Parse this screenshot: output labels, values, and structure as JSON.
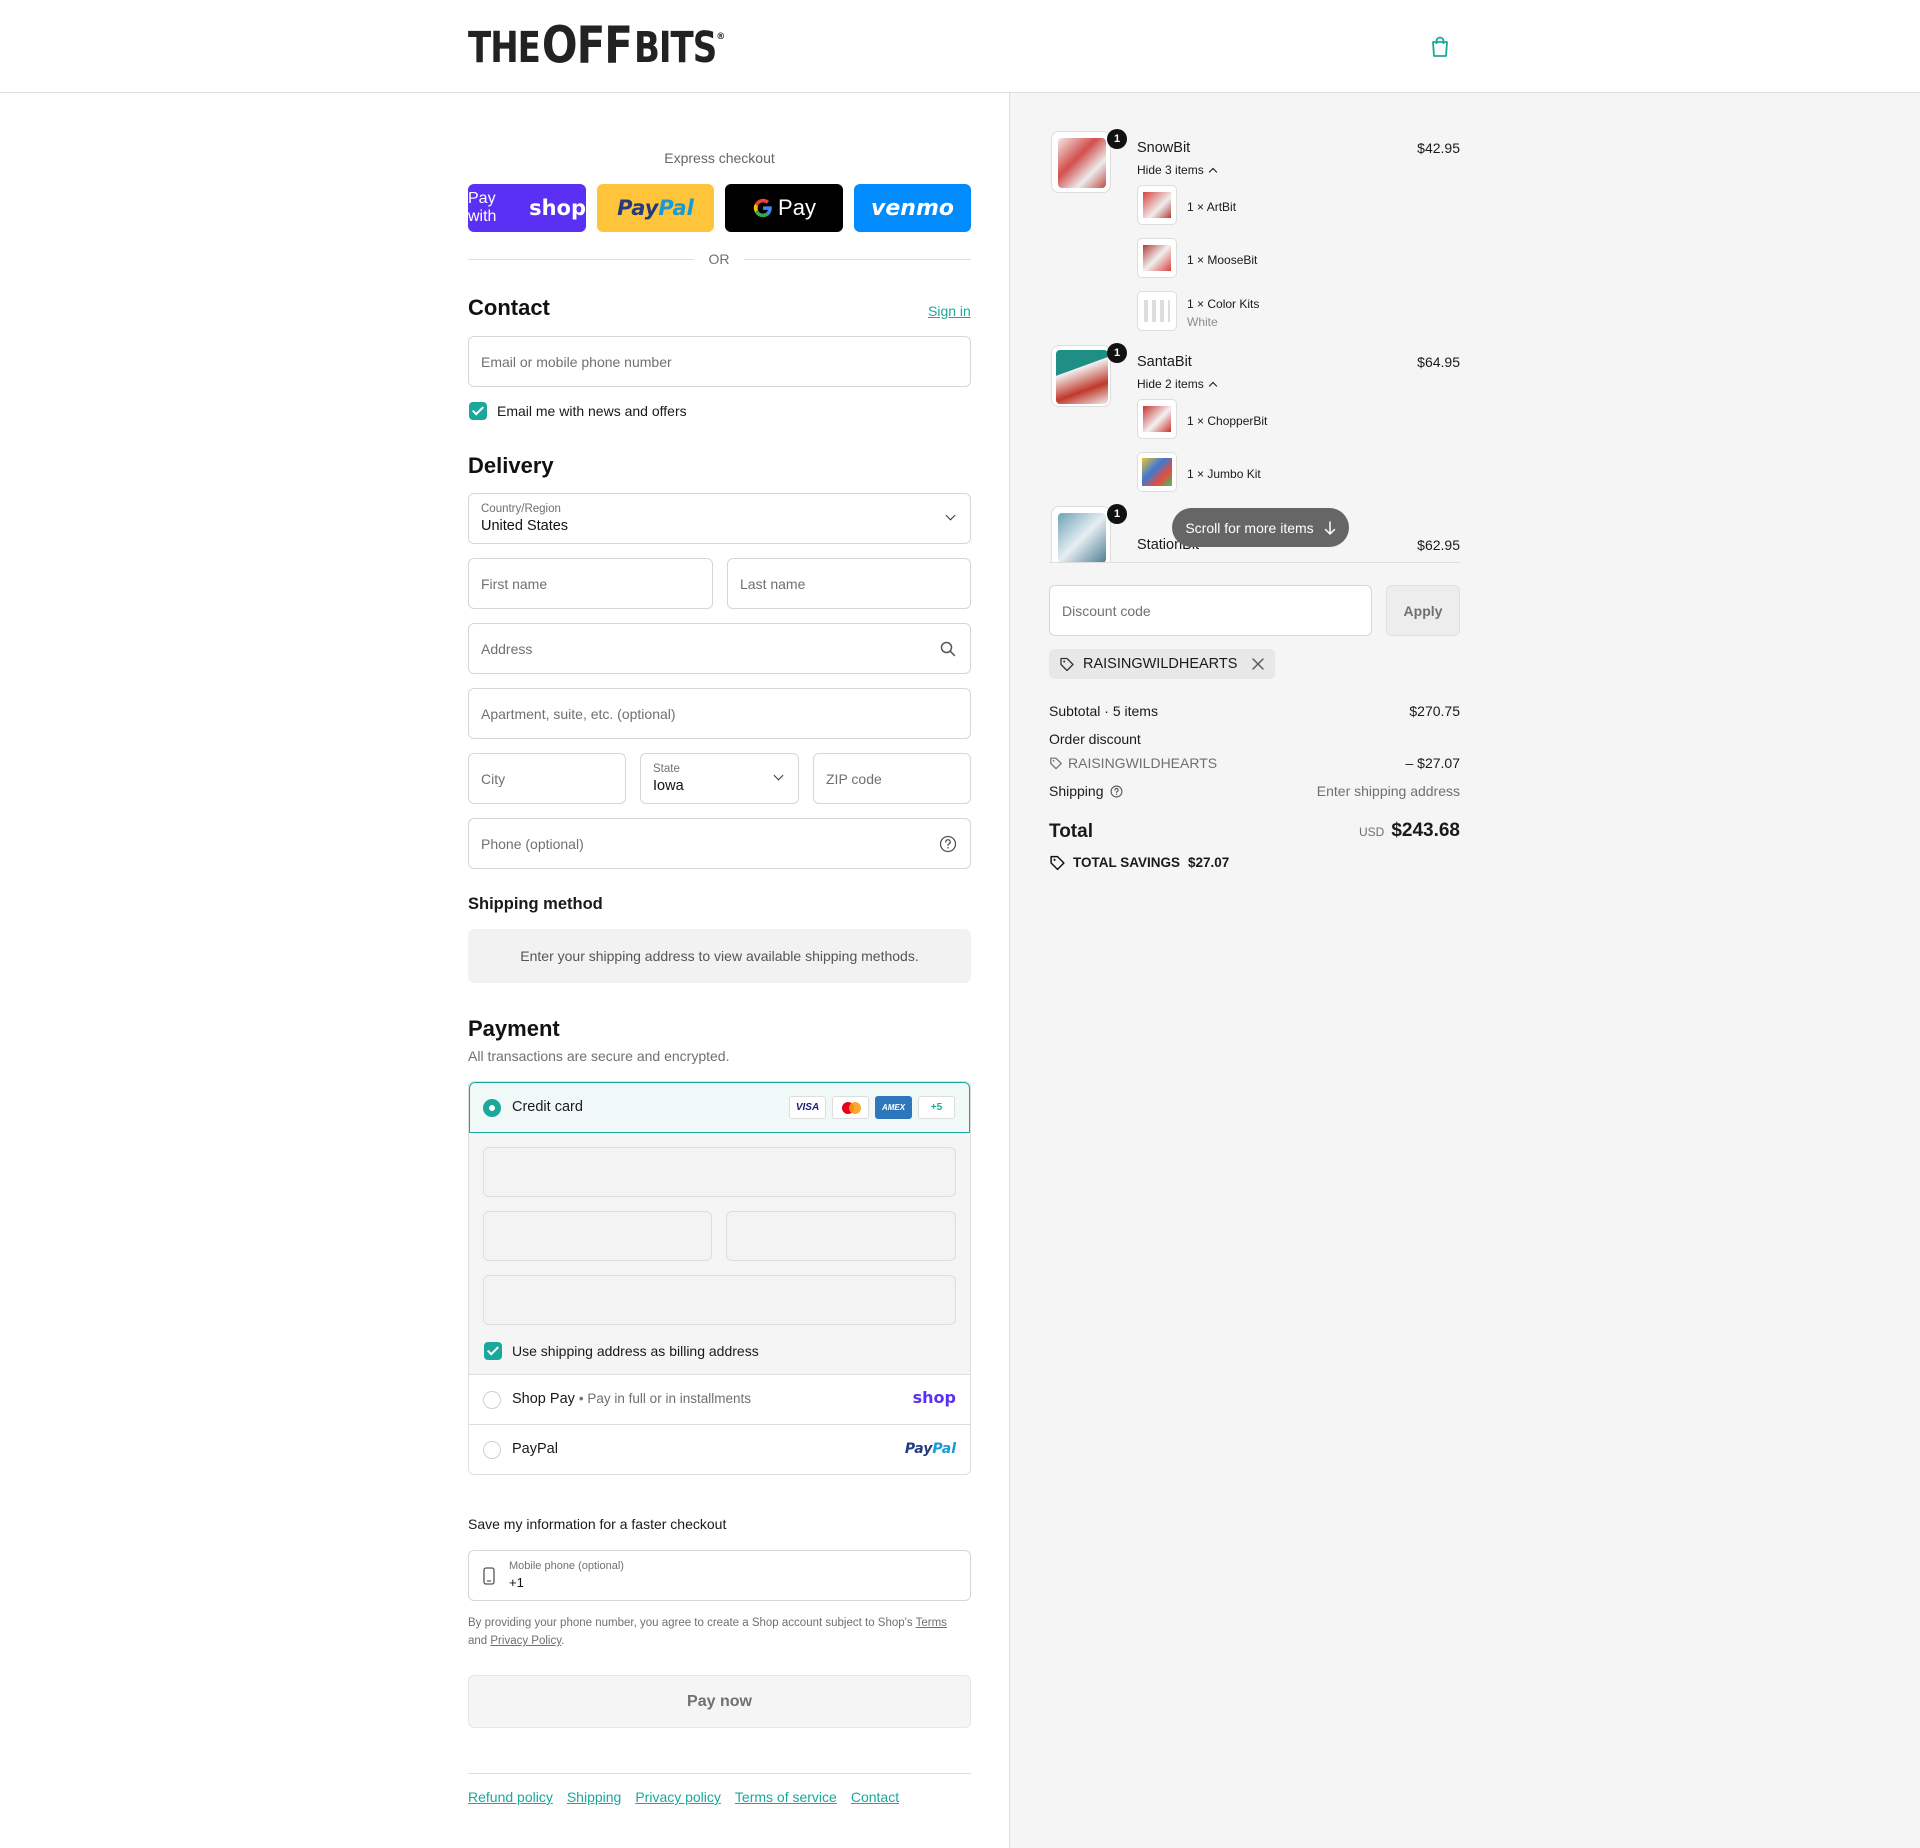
{
  "brand": {
    "logo_left": "THE",
    "logo_mid": "OFF",
    "logo_right": "BITS",
    "logo_reg": "®"
  },
  "express": {
    "title": "Express checkout",
    "shop_pay_prefix": "Pay with",
    "shop_pay_brand": "shop",
    "paypal_a": "Pay",
    "paypal_b": "Pal",
    "gpay": "Pay",
    "venmo": "venmo",
    "or": "OR"
  },
  "contact": {
    "title": "Contact",
    "sign_in": "Sign in",
    "email_placeholder": "Email or mobile phone number",
    "news_label": "Email me with news and offers"
  },
  "delivery": {
    "title": "Delivery",
    "country_label": "Country/Region",
    "country_value": "United States",
    "first_name": "First name",
    "last_name": "Last name",
    "address": "Address",
    "apartment": "Apartment, suite, etc. (optional)",
    "city": "City",
    "state_label": "State",
    "state_value": "Iowa",
    "zip": "ZIP code",
    "phone": "Phone (optional)"
  },
  "shipping_method": {
    "title": "Shipping method",
    "message": "Enter your shipping address to view available shipping methods."
  },
  "payment": {
    "title": "Payment",
    "subtitle": "All transactions are secure and encrypted.",
    "credit_card": "Credit card",
    "card_visa": "VISA",
    "card_amex": "AMEX",
    "card_more": "+5",
    "billing_label": "Use shipping address as billing address",
    "shop_pay": "Shop Pay",
    "shop_pay_sub": "Pay in full or in installments",
    "shop_pay_logo": "shop",
    "paypal": "PayPal",
    "paypal_logo_a": "Pay",
    "paypal_logo_b": "Pal"
  },
  "save_info": {
    "title": "Save my information for a faster checkout",
    "mobile_label": "Mobile phone (optional)",
    "mobile_value": "+1",
    "legal_1": "By providing your phone number, you agree to create a Shop account subject to Shop's",
    "terms": "Terms",
    "and": "and",
    "privacy": "Privacy Policy",
    "period": "."
  },
  "pay_now": "Pay now",
  "footer_links": [
    "Refund policy",
    "Shipping",
    "Privacy policy",
    "Terms of service",
    "Contact"
  ],
  "cart": {
    "items": [
      {
        "name": "SnowBit",
        "price": "$42.95",
        "qty": "1",
        "toggle": "Hide 3 items",
        "sub": [
          {
            "qty": "1 ×",
            "name": "ArtBit",
            "variant": ""
          },
          {
            "qty": "1 ×",
            "name": "MooseBit",
            "variant": ""
          },
          {
            "qty": "1 ×",
            "name": "Color Kits",
            "variant": "White"
          }
        ]
      },
      {
        "name": "SantaBit",
        "price": "$64.95",
        "qty": "1",
        "toggle": "Hide 2 items",
        "sub": [
          {
            "qty": "1 ×",
            "name": "ChopperBit",
            "variant": ""
          },
          {
            "qty": "1 ×",
            "name": "Jumbo Kit",
            "variant": ""
          }
        ]
      },
      {
        "name": "StationBit",
        "price": "$62.95",
        "qty": "1"
      }
    ],
    "scroll_hint": "Scroll for more items",
    "discount_placeholder": "Discount code",
    "apply": "Apply",
    "applied_code": "RAISINGWILDHEARTS",
    "subtotal_label": "Subtotal · 5 items",
    "subtotal_value": "$270.75",
    "order_discount_label": "Order discount",
    "order_discount_code": "RAISINGWILDHEARTS",
    "order_discount_value": "– $27.07",
    "shipping_label": "Shipping",
    "shipping_value": "Enter shipping address",
    "total_label": "Total",
    "total_currency": "USD",
    "total_value": "$243.68",
    "savings_label": "TOTAL SAVINGS",
    "savings_value": "$27.07"
  },
  "colors": {
    "accent": "#1aa89c",
    "shop_purple": "#5a31f4",
    "paypal_yellow": "#ffc439",
    "venmo_blue": "#008cff"
  }
}
